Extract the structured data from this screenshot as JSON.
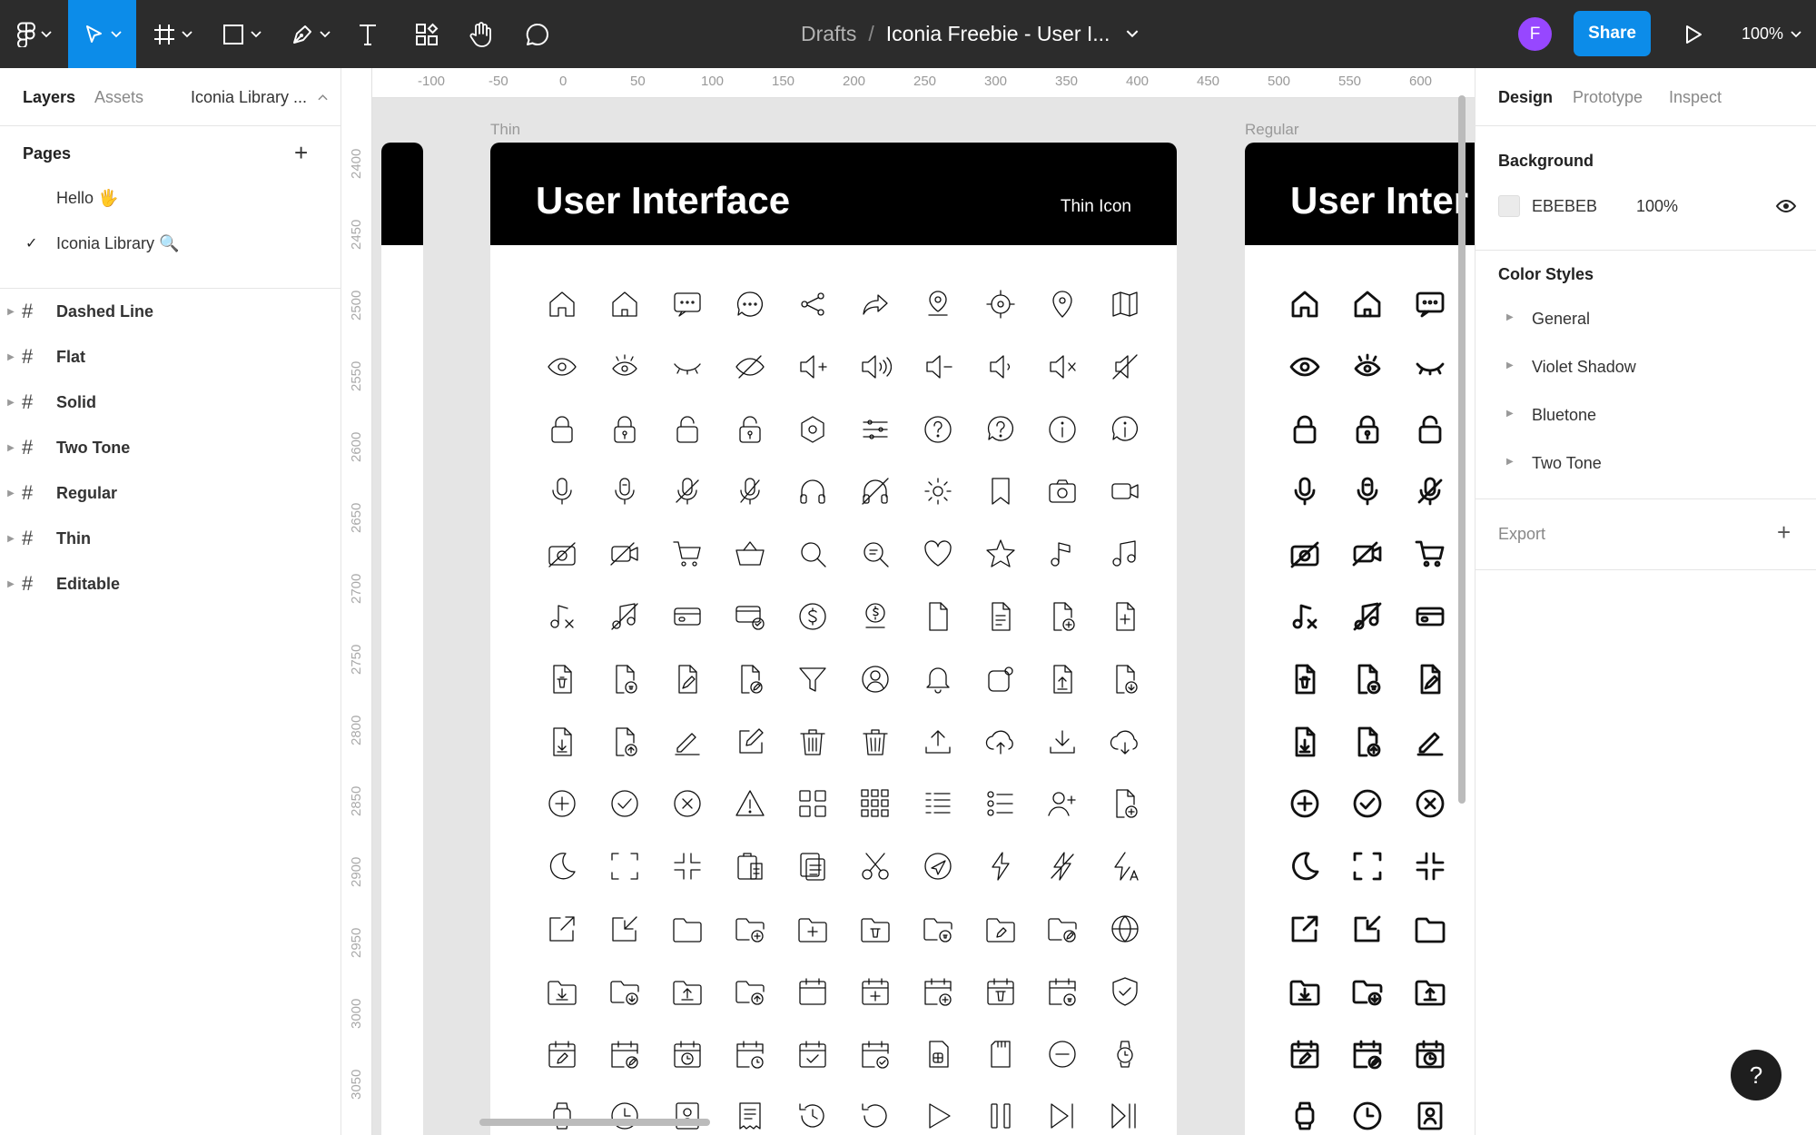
{
  "toolbar": {
    "tools": [
      {
        "name": "main-menu",
        "icon": "figma-logo-icon"
      },
      {
        "name": "move-tool",
        "icon": "cursor-arrow-icon"
      },
      {
        "name": "frame-tool",
        "icon": "frame-hash-icon"
      },
      {
        "name": "shape-tool",
        "icon": "rectangle-icon"
      },
      {
        "name": "pen-tool",
        "icon": "pen-icon"
      },
      {
        "name": "text-tool",
        "icon": "text-icon"
      },
      {
        "name": "resources-tool",
        "icon": "components-icon"
      },
      {
        "name": "hand-tool",
        "icon": "hand-icon"
      },
      {
        "name": "comment-tool",
        "icon": "comment-icon"
      }
    ],
    "drafts_label": "Drafts",
    "separator": "/",
    "file_name": "Iconia Freebie - User I...",
    "avatar_initial": "F",
    "share_label": "Share",
    "zoom_label": "100%",
    "accent": "#0c8ce9",
    "avatar_color": "#9747ff"
  },
  "left_panel": {
    "tabs": [
      "Layers",
      "Assets"
    ],
    "library_label": "Iconia Library ...",
    "pages_heading": "Pages",
    "pages": [
      {
        "label": "Hello 🖐",
        "selected": false
      },
      {
        "label": "Iconia Library 🔍",
        "selected": true
      }
    ],
    "layers": [
      "Dashed Line",
      "Flat",
      "Solid",
      "Two Tone",
      "Regular",
      "Thin",
      "Editable"
    ]
  },
  "canvas": {
    "ruler_x": [
      "-100",
      "-50",
      "0",
      "50",
      "100",
      "150",
      "200",
      "250",
      "300",
      "350",
      "400",
      "450",
      "500",
      "550",
      "600"
    ],
    "ruler_y": [
      "2400",
      "2450",
      "2500",
      "2550",
      "2600",
      "2650",
      "2700",
      "2750",
      "2800",
      "2850",
      "2900",
      "2950",
      "3000",
      "3050"
    ],
    "thin_frame": {
      "label": "Thin",
      "title": "User Interface",
      "subtitle": "Thin Icon"
    },
    "regular_frame": {
      "label": "Regular",
      "title": "User Inter"
    }
  },
  "right_panel": {
    "tabs": [
      "Design",
      "Prototype",
      "Inspect"
    ],
    "background_heading": "Background",
    "background_hex": "EBEBEB",
    "background_opacity": "100%",
    "background_color": "#EBEBEB",
    "color_styles_heading": "Color Styles",
    "color_styles": [
      "General",
      "Violet Shadow",
      "Bluetone",
      "Two Tone"
    ],
    "export_heading": "Export"
  },
  "help_label": "?"
}
